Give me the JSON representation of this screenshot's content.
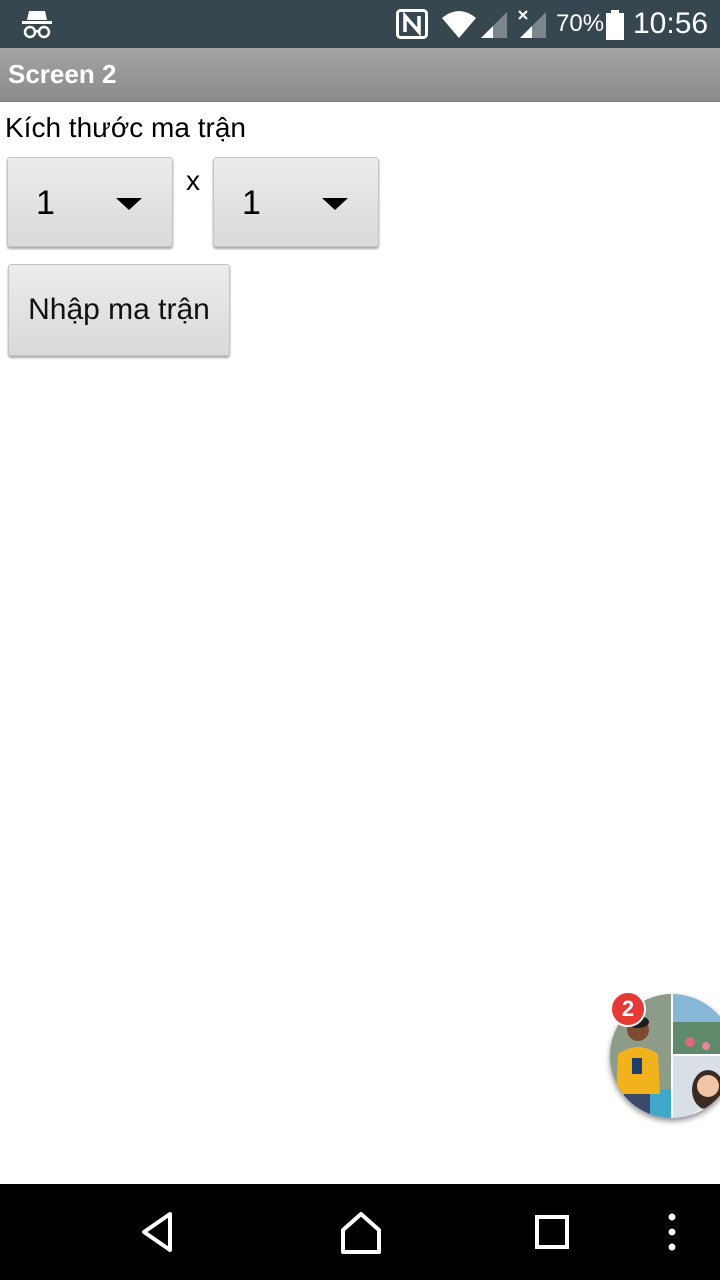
{
  "status_bar": {
    "battery_percent": "70%",
    "time": "10:56",
    "icons": [
      "incognito-icon",
      "nfc-icon",
      "wifi-icon",
      "cell-signal-icon",
      "cell-signal-no-data-icon",
      "battery-icon"
    ]
  },
  "app": {
    "title": "Screen 2"
  },
  "matrix": {
    "size_label": "Kích thước ma trận",
    "rows_value": "1",
    "times_symbol": "x",
    "cols_value": "1",
    "enter_button_label": "Nhập ma trận"
  },
  "chat_head": {
    "badge_count": "2"
  },
  "nav_bar": {
    "icons": [
      "back-icon",
      "home-icon",
      "recents-icon",
      "menu-icon"
    ]
  },
  "colors": {
    "status_bar_bg": "#37474f",
    "title_bar_bg": "#999999",
    "badge": "#e53935"
  }
}
